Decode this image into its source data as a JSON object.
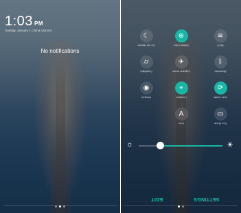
{
  "lock_screen": {
    "time": "1:03",
    "ampm": "PM",
    "date_carrier": "Sunday, January 1 China Unicom",
    "empty_text": "No notifications",
    "page_indicator": {
      "count": 3,
      "active": 2
    }
  },
  "quick_settings": {
    "tiles": [
      {
        "label": "Do not disturb",
        "icon": "moon-icon",
        "active": false
      },
      {
        "label": "Mobile Data",
        "icon": "globe-icon",
        "active": true
      },
      {
        "label": "Wi-Fi",
        "icon": "wifi-icon",
        "active": false
      },
      {
        "label": "Flashlight",
        "icon": "flashlight-icon",
        "active": false
      },
      {
        "label": "Airplane mode",
        "icon": "airplane-icon",
        "active": false
      },
      {
        "label": "Bluetooth",
        "icon": "bluetooth-icon",
        "active": false
      },
      {
        "label": "Hotspot",
        "icon": "hotspot-icon",
        "active": false
      },
      {
        "label": "Location",
        "icon": "location-pin-icon",
        "active": true
      },
      {
        "label": "Auto-rotate",
        "icon": "auto-rotate-icon",
        "active": true
      },
      {
        "label": "Auto",
        "icon": "auto-brightness-icon",
        "active": false
      },
      {
        "label": "Eco Mode",
        "icon": "battery-icon",
        "active": false
      }
    ],
    "brightness_fraction": 0.25,
    "edit_label": "EDIT",
    "settings_label": "SETTINGS",
    "page_indicator": {
      "count": 2,
      "active": 1
    }
  },
  "colors": {
    "accent": "#18b6a5",
    "button_text": "#17c2ae"
  }
}
